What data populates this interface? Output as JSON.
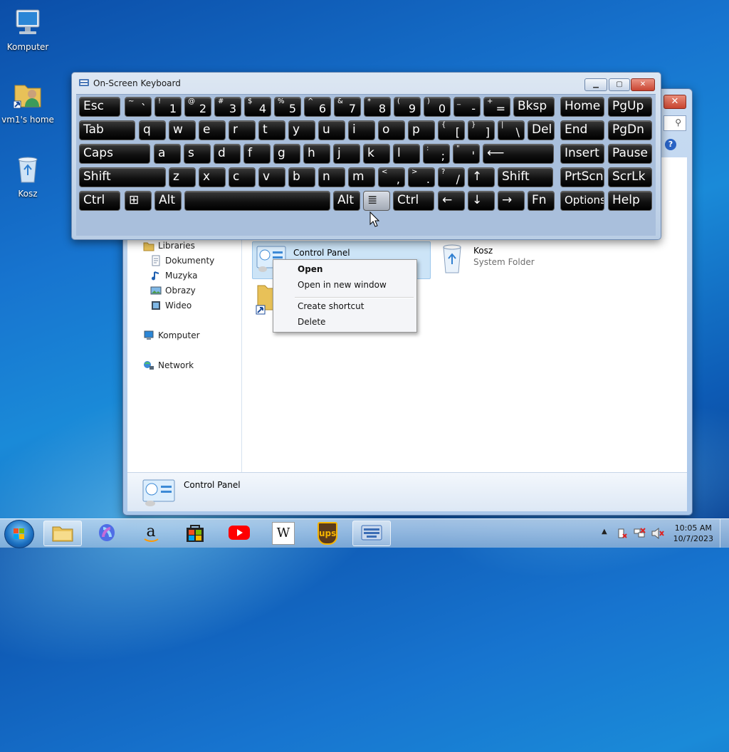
{
  "desktop": {
    "icons": [
      {
        "label": "Komputer",
        "icon": "computer-icon"
      },
      {
        "label": "vm1's home",
        "icon": "user-folder-icon"
      },
      {
        "label": "Kosz",
        "icon": "recycle-bin-icon"
      }
    ]
  },
  "explorer": {
    "close_label": "✕",
    "nav": {
      "libraries": "Libraries",
      "items": [
        "Dokumenty",
        "Muzyka",
        "Obrazy",
        "Wideo"
      ],
      "computer": "Komputer",
      "network": "Network"
    },
    "items": [
      {
        "name": "Control Panel",
        "sub": ""
      },
      {
        "name": "Kosz",
        "sub": "System Folder"
      }
    ],
    "details_title": "Control Panel"
  },
  "context_menu": {
    "items": [
      "Open",
      "Open in new window",
      "Create shortcut",
      "Delete"
    ]
  },
  "osk": {
    "title": "On-Screen Keyboard",
    "row1": [
      {
        "l": "Esc"
      },
      {
        "u": "~",
        "d": "`"
      },
      {
        "u": "!",
        "d": "1"
      },
      {
        "u": "@",
        "d": "2"
      },
      {
        "u": "#",
        "d": "3"
      },
      {
        "u": "$",
        "d": "4"
      },
      {
        "u": "%",
        "d": "5"
      },
      {
        "u": "^",
        "d": "6"
      },
      {
        "u": "&",
        "d": "7"
      },
      {
        "u": "*",
        "d": "8"
      },
      {
        "u": "(",
        "d": "9"
      },
      {
        "u": ")",
        "d": "0"
      },
      {
        "u": "_",
        "d": "-"
      },
      {
        "u": "+",
        "d": "="
      },
      {
        "l": "Bksp"
      },
      {
        "l": "Home"
      },
      {
        "l": "PgUp"
      }
    ],
    "row2": [
      {
        "l": "Tab"
      },
      {
        "l": "q"
      },
      {
        "l": "w"
      },
      {
        "l": "e"
      },
      {
        "l": "r"
      },
      {
        "l": "t"
      },
      {
        "l": "y"
      },
      {
        "l": "u"
      },
      {
        "l": "i"
      },
      {
        "l": "o"
      },
      {
        "l": "p"
      },
      {
        "u": "{",
        "d": "["
      },
      {
        "u": "}",
        "d": "]"
      },
      {
        "u": "|",
        "d": "\\"
      },
      {
        "l": "Del"
      },
      {
        "l": "End"
      },
      {
        "l": "PgDn"
      }
    ],
    "row3": [
      {
        "l": "Caps"
      },
      {
        "l": "a"
      },
      {
        "l": "s"
      },
      {
        "l": "d"
      },
      {
        "l": "f"
      },
      {
        "l": "g"
      },
      {
        "l": "h"
      },
      {
        "l": "j"
      },
      {
        "l": "k"
      },
      {
        "l": "l"
      },
      {
        "u": ":",
        "d": ";"
      },
      {
        "u": "\"",
        "d": "'"
      },
      {
        "l": "⟵"
      },
      {
        "l": "Insert"
      },
      {
        "l": "Pause"
      }
    ],
    "row4": [
      {
        "l": "Shift"
      },
      {
        "l": "z"
      },
      {
        "l": "x"
      },
      {
        "l": "c"
      },
      {
        "l": "v"
      },
      {
        "l": "b"
      },
      {
        "l": "n"
      },
      {
        "l": "m"
      },
      {
        "u": "<",
        "d": ","
      },
      {
        "u": ">",
        "d": "."
      },
      {
        "u": "?",
        "d": "/"
      },
      {
        "l": "↑"
      },
      {
        "l": "Shift"
      },
      {
        "l": "PrtScn"
      },
      {
        "l": "ScrLk"
      }
    ],
    "row5": [
      {
        "l": "Ctrl"
      },
      {
        "l": "⊞"
      },
      {
        "l": "Alt"
      },
      {
        "l": ""
      },
      {
        "l": "Alt"
      },
      {
        "l": "≣"
      },
      {
        "l": "Ctrl"
      },
      {
        "l": "←"
      },
      {
        "l": "↓"
      },
      {
        "l": "→"
      },
      {
        "l": "Fn"
      },
      {
        "l": "Options"
      },
      {
        "l": "Help"
      }
    ]
  },
  "taskbar": {
    "apps": [
      {
        "name": "windows-explorer-icon"
      },
      {
        "name": "copilot-icon"
      },
      {
        "name": "amazon-icon"
      },
      {
        "name": "store-bag-icon"
      },
      {
        "name": "youtube-icon"
      },
      {
        "name": "wikipedia-icon",
        "text": "W"
      },
      {
        "name": "ups-icon",
        "text": "ups"
      },
      {
        "name": "on-screen-keyboard-icon"
      }
    ],
    "time": "10:05 AM",
    "date": "10/7/2023"
  },
  "colors": {
    "accent": "#1a6fc4",
    "selection": "#cce4f7"
  }
}
